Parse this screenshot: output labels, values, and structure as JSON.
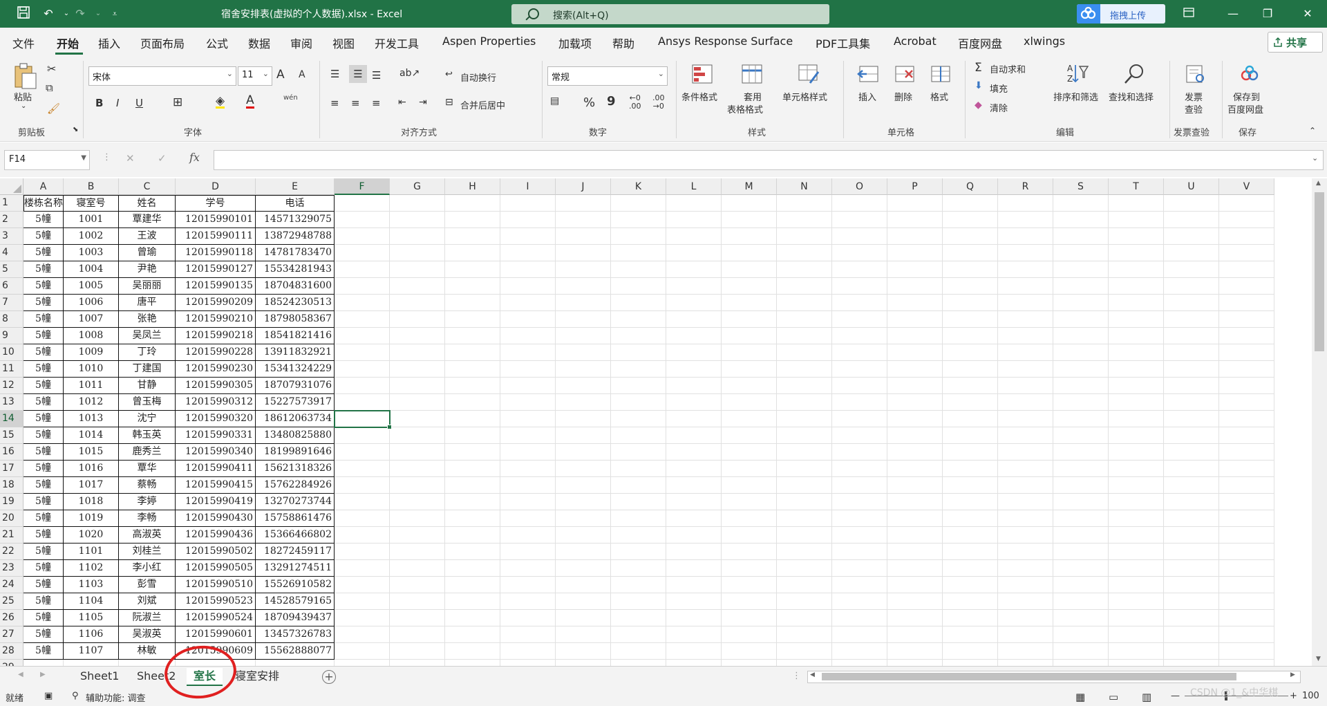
{
  "window": {
    "title": "宿舍安排表(虚拟的个人数据).xlsx  -  Excel",
    "search_placeholder": "搜索(Alt+Q)",
    "upload_label": "拖拽上传",
    "accent_color": "#217346"
  },
  "menu": {
    "items": [
      "文件",
      "开始",
      "插入",
      "页面布局",
      "公式",
      "数据",
      "审阅",
      "视图",
      "开发工具",
      "Aspen Properties",
      "加载项",
      "帮助",
      "Ansys Response Surface",
      "PDF工具集",
      "Acrobat",
      "百度网盘",
      "xlwings"
    ],
    "active": "开始",
    "share_label": "共享"
  },
  "ribbon": {
    "clipboard": {
      "paste": "粘贴",
      "group": "剪贴板"
    },
    "font": {
      "name": "宋体",
      "size": "11",
      "group": "字体",
      "bold": "B",
      "italic": "I",
      "underline": "U",
      "grow": "A",
      "shrink": "A",
      "phonetic": "wén"
    },
    "alignment": {
      "wrap": "自动换行",
      "merge": "合并后居中",
      "group": "对齐方式"
    },
    "number": {
      "format": "常规",
      "percent": "%",
      "comma": "9",
      "group": "数字"
    },
    "styles": {
      "conditional": "条件格式",
      "table_1": "套用",
      "table_2": "表格格式",
      "cell": "单元格样式",
      "group": "样式"
    },
    "cells": {
      "insert": "插入",
      "delete": "删除",
      "format": "格式",
      "group": "单元格"
    },
    "editing": {
      "autosum": "自动求和",
      "fill": "填充",
      "clear": "清除",
      "sort": "排序和筛选",
      "find": "查找和选择",
      "group": "编辑"
    },
    "invoice": {
      "check_1": "发票",
      "check_2": "查验",
      "group": "发票查验"
    },
    "save": {
      "baidu_1": "保存到",
      "baidu_2": "百度网盘",
      "group": "保存"
    }
  },
  "formula_bar": {
    "name_box": "F14",
    "cancel": "✕",
    "enter": "✓",
    "fx": "fx",
    "content": ""
  },
  "sheet": {
    "columns": [
      "A",
      "B",
      "C",
      "D",
      "E",
      "F",
      "G",
      "H",
      "I",
      "J",
      "K",
      "L",
      "M",
      "N",
      "O",
      "P",
      "Q",
      "R",
      "S",
      "T",
      "U",
      "V"
    ],
    "selected_column": "F",
    "selected_row": 14,
    "active_cell": "F14",
    "header_row": [
      "楼栋名称",
      "寝室号",
      "姓名",
      "学号",
      "电话"
    ],
    "rows": [
      [
        "5幢",
        "1001",
        "覃建华",
        "12015990101",
        "14571329075"
      ],
      [
        "5幢",
        "1002",
        "王波",
        "12015990111",
        "13872948788"
      ],
      [
        "5幢",
        "1003",
        "曾瑜",
        "12015990118",
        "14781783470"
      ],
      [
        "5幢",
        "1004",
        "尹艳",
        "12015990127",
        "15534281943"
      ],
      [
        "5幢",
        "1005",
        "吴丽丽",
        "12015990135",
        "18704831600"
      ],
      [
        "5幢",
        "1006",
        "唐平",
        "12015990209",
        "18524230513"
      ],
      [
        "5幢",
        "1007",
        "张艳",
        "12015990210",
        "18798058367"
      ],
      [
        "5幢",
        "1008",
        "吴凤兰",
        "12015990218",
        "18541821416"
      ],
      [
        "5幢",
        "1009",
        "丁玲",
        "12015990228",
        "13911832921"
      ],
      [
        "5幢",
        "1010",
        "丁建国",
        "12015990230",
        "15341324229"
      ],
      [
        "5幢",
        "1011",
        "甘静",
        "12015990305",
        "18707931076"
      ],
      [
        "5幢",
        "1012",
        "曾玉梅",
        "12015990312",
        "15227573917"
      ],
      [
        "5幢",
        "1013",
        "沈宁",
        "12015990320",
        "18612063734"
      ],
      [
        "5幢",
        "1014",
        "韩玉英",
        "12015990331",
        "13480825880"
      ],
      [
        "5幢",
        "1015",
        "鹿秀兰",
        "12015990340",
        "18199891646"
      ],
      [
        "5幢",
        "1016",
        "覃华",
        "12015990411",
        "15621318326"
      ],
      [
        "5幢",
        "1017",
        "蔡畅",
        "12015990415",
        "15762284926"
      ],
      [
        "5幢",
        "1018",
        "李婷",
        "12015990419",
        "13270273744"
      ],
      [
        "5幢",
        "1019",
        "李畅",
        "12015990430",
        "15758861476"
      ],
      [
        "5幢",
        "1020",
        "高淑英",
        "12015990436",
        "15366466802"
      ],
      [
        "5幢",
        "1101",
        "刘桂兰",
        "12015990502",
        "18272459117"
      ],
      [
        "5幢",
        "1102",
        "李小红",
        "12015990505",
        "13291274511"
      ],
      [
        "5幢",
        "1103",
        "彭雪",
        "12015990510",
        "15526910582"
      ],
      [
        "5幢",
        "1104",
        "刘斌",
        "12015990523",
        "14528579165"
      ],
      [
        "5幢",
        "1105",
        "阮淑兰",
        "12015990524",
        "18709439437"
      ],
      [
        "5幢",
        "1106",
        "吴淑英",
        "12015990601",
        "13457326783"
      ],
      [
        "5幢",
        "1107",
        "林敏",
        "12015990609",
        "15562888077"
      ]
    ]
  },
  "tabs": {
    "items": [
      "Sheet1",
      "Sheet2",
      "室长",
      "寝室安排"
    ],
    "active": "室长",
    "add": "+"
  },
  "status": {
    "ready": "就绪",
    "accessibility": "辅助功能: 调查",
    "zoom": "100",
    "watermark": "CSDN @1_&中华棋"
  }
}
